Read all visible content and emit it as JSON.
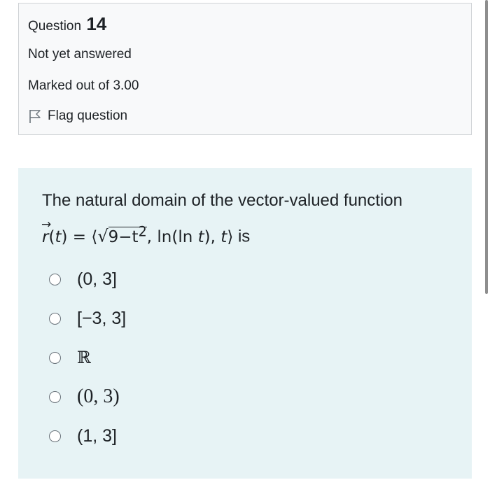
{
  "question_info": {
    "label": "Question",
    "number": "14",
    "state": "Not yet answered",
    "grade": "Marked out of 3.00",
    "flag_label": "Flag question"
  },
  "question": {
    "text_intro": "The natural domain of the vector-valued function",
    "formula": {
      "vector_arrow": "→",
      "r": "r",
      "t_paren_open": "(",
      "t": "t",
      "t_paren_close": ")",
      "equals": " = ",
      "angle_open": "⟨",
      "sqrt_symbol": "√",
      "radicand": "9−t",
      "exponent": "2",
      "second_comp": ", ln(ln ",
      "second_t": "t",
      "second_close": "), ",
      "third_t": "t",
      "angle_close": "⟩"
    },
    "text_end": " is"
  },
  "options": [
    {
      "label": "(0, 3]"
    },
    {
      "label": "[−3, 3]"
    },
    {
      "label": "ℝ"
    },
    {
      "label": "(0, 3)"
    },
    {
      "label": "(1, 3]"
    }
  ],
  "colors": {
    "info_bg": "#f8f9fa",
    "info_border": "#d0d3d6",
    "content_bg": "#e7f3f5",
    "text": "#1d2125"
  },
  "icons": {
    "flag": "flag-outline-icon",
    "radio": "radio-unchecked-icon"
  }
}
